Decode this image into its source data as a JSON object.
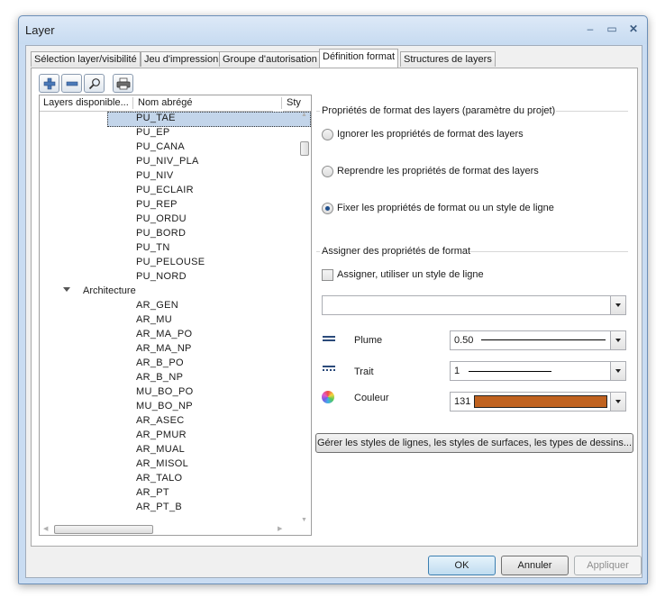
{
  "window": {
    "title": "Layer",
    "minimize_glyph": "–",
    "maximize_glyph": "▭",
    "close_glyph": "✕"
  },
  "tabs": [
    {
      "label": "Sélection layer/visibilité",
      "active": false
    },
    {
      "label": "Jeu d'impression",
      "active": false
    },
    {
      "label": "Groupe d'autorisation",
      "active": false
    },
    {
      "label": "Définition format",
      "active": true
    },
    {
      "label": "Structures de layers",
      "active": false
    }
  ],
  "toolbar": {
    "icons": [
      "add-layer-icon",
      "remove-layer-icon",
      "search-icon",
      "print-icon"
    ]
  },
  "layer_tree": {
    "columns": [
      "Layers disponible...",
      "Nom abrégé",
      "Sty"
    ],
    "items": [
      {
        "type": "leaf",
        "label": "PU_TAE",
        "selected": true
      },
      {
        "type": "leaf",
        "label": "PU_EP"
      },
      {
        "type": "leaf",
        "label": "PU_CANA"
      },
      {
        "type": "leaf",
        "label": "PU_NIV_PLA"
      },
      {
        "type": "leaf",
        "label": "PU_NIV"
      },
      {
        "type": "leaf",
        "label": "PU_ECLAIR"
      },
      {
        "type": "leaf",
        "label": "PU_REP"
      },
      {
        "type": "leaf",
        "label": "PU_ORDU"
      },
      {
        "type": "leaf",
        "label": "PU_BORD"
      },
      {
        "type": "leaf",
        "label": "PU_TN"
      },
      {
        "type": "leaf",
        "label": "PU_PELOUSE"
      },
      {
        "type": "leaf",
        "label": "PU_NORD"
      },
      {
        "type": "group",
        "label": "Architecture"
      },
      {
        "type": "leaf",
        "label": "AR_GEN"
      },
      {
        "type": "leaf",
        "label": "AR_MU"
      },
      {
        "type": "leaf",
        "label": "AR_MA_PO"
      },
      {
        "type": "leaf",
        "label": "AR_MA_NP"
      },
      {
        "type": "leaf",
        "label": "AR_B_PO"
      },
      {
        "type": "leaf",
        "label": "AR_B_NP"
      },
      {
        "type": "leaf",
        "label": "MU_BO_PO"
      },
      {
        "type": "leaf",
        "label": "MU_BO_NP"
      },
      {
        "type": "leaf",
        "label": "AR_ASEC"
      },
      {
        "type": "leaf",
        "label": "AR_PMUR"
      },
      {
        "type": "leaf",
        "label": "AR_MUAL"
      },
      {
        "type": "leaf",
        "label": "AR_MISOL"
      },
      {
        "type": "leaf",
        "label": "AR_TALO"
      },
      {
        "type": "leaf",
        "label": "AR_PT"
      },
      {
        "type": "leaf",
        "label": "AR_PT_B"
      }
    ]
  },
  "format_properties": {
    "group_title": "Propriétés de format des layers (paramètre du projet)",
    "options": [
      {
        "label": "Ignorer les propriétés de format des layers",
        "checked": false
      },
      {
        "label": "Reprendre les propriétés de format des layers",
        "checked": false
      },
      {
        "label": "Fixer les propriétés de format ou un style de ligne",
        "checked": true
      }
    ]
  },
  "assign": {
    "group_title": "Assigner des propriétés de format",
    "line_style_checkbox": "Assigner, utiliser un style de ligne",
    "line_style_value": "",
    "pen": {
      "label": "Plume",
      "value": "0.50",
      "icon": "pen-thickness-icon"
    },
    "stroke": {
      "label": "Trait",
      "value": "1",
      "icon": "line-type-icon"
    },
    "color": {
      "label": "Couleur",
      "value": "131",
      "swatch": "#c0621f",
      "icon": "color-wheel-icon"
    },
    "manage_button": "Gérer les styles de lignes, les styles de surfaces, les types de dessins..."
  },
  "buttons": {
    "ok": "OK",
    "cancel": "Annuler",
    "apply": "Appliquer"
  }
}
